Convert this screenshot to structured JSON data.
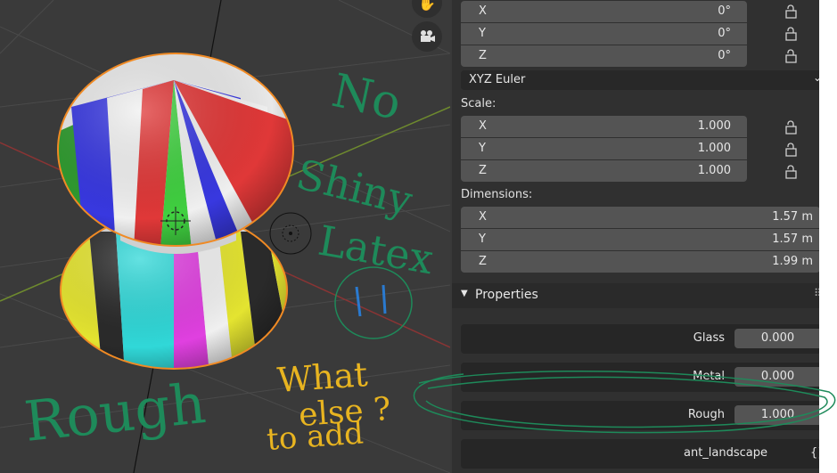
{
  "rotation": {
    "fields": [
      {
        "axis": "X",
        "value": "0°"
      },
      {
        "axis": "Y",
        "value": "0°"
      },
      {
        "axis": "Z",
        "value": "0°"
      }
    ],
    "mode": "XYZ Euler"
  },
  "scale": {
    "label": "Scale:",
    "fields": [
      {
        "axis": "X",
        "value": "1.000"
      },
      {
        "axis": "Y",
        "value": "1.000"
      },
      {
        "axis": "Z",
        "value": "1.000"
      }
    ]
  },
  "dimensions": {
    "label": "Dimensions:",
    "fields": [
      {
        "axis": "X",
        "value": "1.57 m"
      },
      {
        "axis": "Y",
        "value": "1.57 m"
      },
      {
        "axis": "Z",
        "value": "1.99 m"
      }
    ]
  },
  "properties": {
    "title": "Properties",
    "items": [
      {
        "label": "Glass",
        "value": "0.000"
      },
      {
        "label": "Metal",
        "value": "0.000"
      },
      {
        "label": "Rough",
        "value": "1.000"
      },
      {
        "label": "ant_landscape",
        "value": "{}"
      }
    ]
  },
  "annotations": {
    "no_shiny_latex": [
      "No",
      "Shiny",
      "Latex"
    ],
    "rough": "Rough",
    "what_else": [
      "What",
      "else ?",
      "to add"
    ]
  },
  "icons": {
    "pan_tool": "hand-icon",
    "camera_view": "camera-icon",
    "lock": "lock-icon",
    "collapse": "triangle-down-icon",
    "grip": "drag-grip-icon"
  },
  "colors": {
    "panel_bg": "#303030",
    "field_bg": "#545454",
    "viewport_bg": "#3a3a3a",
    "annotation_green": "#1e8a5a",
    "annotation_yellow": "#e8b420",
    "selection_outline": "#f08a24"
  }
}
